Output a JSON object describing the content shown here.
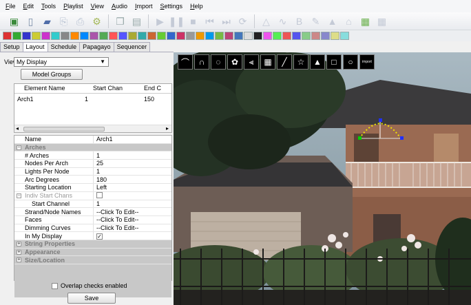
{
  "menubar": [
    "File",
    "Edit",
    "Tools",
    "Playlist",
    "View",
    "Audio",
    "Import",
    "Settings",
    "Help"
  ],
  "toolbar": {
    "icons": [
      "save-sequence-icon",
      "new-sequence-icon",
      "open-folder-icon",
      "export-icon",
      "print-icon",
      "settings-gear-icon",
      "copy-icon",
      "paste-icon",
      "play-icon",
      "pause-icon",
      "stop-icon",
      "step-back-icon",
      "step-forward-icon",
      "loop-icon",
      "triangle-icon",
      "wave-icon",
      "letter-b-icon",
      "brush-icon",
      "tree-icon",
      "house-icon",
      "color-icon",
      "grid-icon"
    ]
  },
  "tabs": [
    "Setup",
    "Layout",
    "Schedule",
    "Papagayo",
    "Sequencer"
  ],
  "active_tab": "Layout",
  "view": {
    "label": "View:",
    "selected": "My Display"
  },
  "model_groups_label": "Model Groups",
  "element_list": {
    "columns": [
      "Element Name",
      "Start Chan",
      "End C"
    ],
    "rows": [
      {
        "name": "Arch1",
        "start": "1",
        "end": "150"
      }
    ]
  },
  "properties": {
    "name_label": "Name",
    "name_value": "Arch1",
    "arches_category": "Arches",
    "rows": [
      {
        "key": "# Arches",
        "value": "1"
      },
      {
        "key": "Nodes Per Arch",
        "value": "25"
      },
      {
        "key": "Lights Per Node",
        "value": "1"
      },
      {
        "key": "Arc Degrees",
        "value": "180"
      },
      {
        "key": "Starting Location",
        "value": "Left"
      }
    ],
    "indiv_start_chans": "Indiv Start Chans",
    "start_channel_label": "Start Channel",
    "start_channel_value": "1",
    "edit_rows": [
      {
        "key": "Strand/Node Names",
        "value": "--Click To Edit--"
      },
      {
        "key": "Faces",
        "value": "--Click To Edit--"
      },
      {
        "key": "Dimming Curves",
        "value": "--Click To Edit--"
      }
    ],
    "in_my_display_label": "In My Display",
    "in_my_display_checked": "✓",
    "collapsed_categories": [
      "String Properties",
      "Appearance",
      "Size/Location"
    ]
  },
  "overlap_label": "Overlap checks enabled",
  "save_label": "Save",
  "shape_tools": [
    "arch-icon",
    "candy-cane-icon",
    "circle-icon",
    "spinner-icon",
    "icicle-icon",
    "matrix-icon",
    "single-line-icon",
    "star-icon",
    "tree-icon",
    "window-frame-icon",
    "wreath-icon"
  ],
  "import_label": "import",
  "colors": {
    "accent": "#3d6fd1",
    "arch_dots": "#f2e600",
    "handle_green": "#00d000",
    "handle_blue": "#2030ff"
  }
}
